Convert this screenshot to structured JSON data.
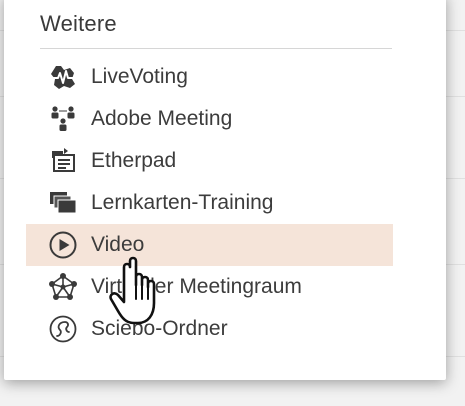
{
  "menu": {
    "title": "Weitere",
    "items": [
      {
        "label": "LiveVoting",
        "icon": "livevoting-icon"
      },
      {
        "label": "Adobe Meeting",
        "icon": "people-group-icon"
      },
      {
        "label": "Etherpad",
        "icon": "etherpad-icon"
      },
      {
        "label": "Lernkarten-Training",
        "icon": "stacked-cards-icon"
      },
      {
        "label": "Video",
        "icon": "play-circle-icon"
      },
      {
        "label": "Virtueller Meetingraum",
        "icon": "network-hub-icon"
      },
      {
        "label": "Sciebo-Ordner",
        "icon": "sciebo-cloud-icon"
      }
    ],
    "active_index": 4,
    "colors": {
      "highlight": "#f5e4d9",
      "text": "#3c3c3c",
      "icon": "#3a3a3a"
    }
  },
  "cursor": {
    "type": "hand-pointer-icon"
  }
}
